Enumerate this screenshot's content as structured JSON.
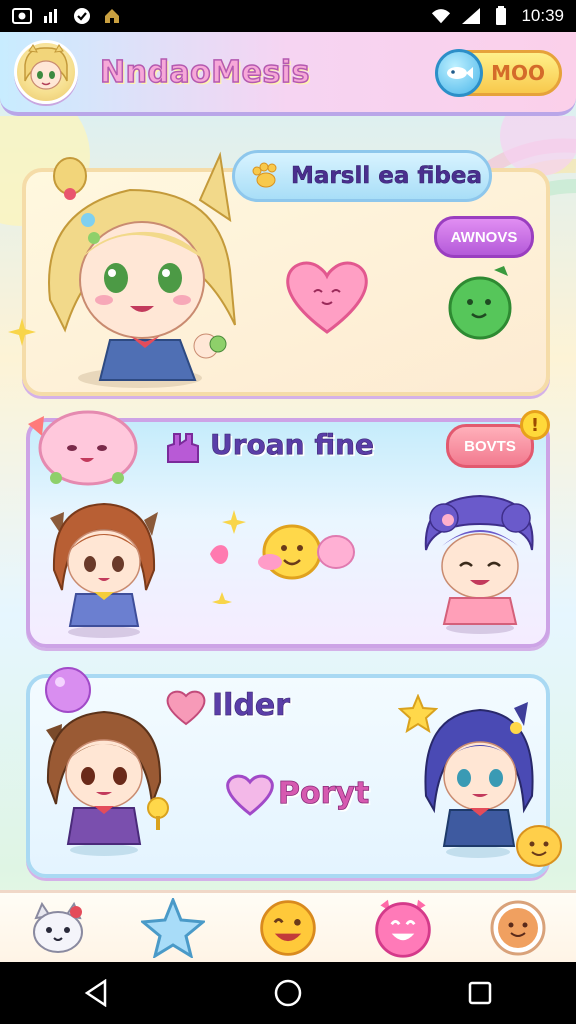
{
  "status_bar": {
    "time": "10:39",
    "left_icons": [
      "photo-icon",
      "chart-icon",
      "shield-check-icon",
      "home-icon"
    ],
    "right_icons": [
      "wifi-icon",
      "signal-icon",
      "battery-icon"
    ]
  },
  "header": {
    "title": "NndaoMesis",
    "mode_label": "MOO"
  },
  "card1": {
    "title": "Marsll ea fibea",
    "button_label": "AWNOVS"
  },
  "card2": {
    "title": "Uroan fine",
    "button_label": "BOVTS",
    "alert": "!"
  },
  "card3": {
    "title": "Ilder",
    "subtitle": "Poryt"
  },
  "bottom_nav": {
    "items": [
      "cat-icon",
      "star-icon",
      "smile-icon",
      "heart-face-icon",
      "cookie-icon"
    ]
  },
  "colors": {
    "accent_pink": "#f7a8d8",
    "accent_purple": "#5a3ea8",
    "accent_yellow": "#f8c94c",
    "accent_blue": "#4bb6ea"
  }
}
